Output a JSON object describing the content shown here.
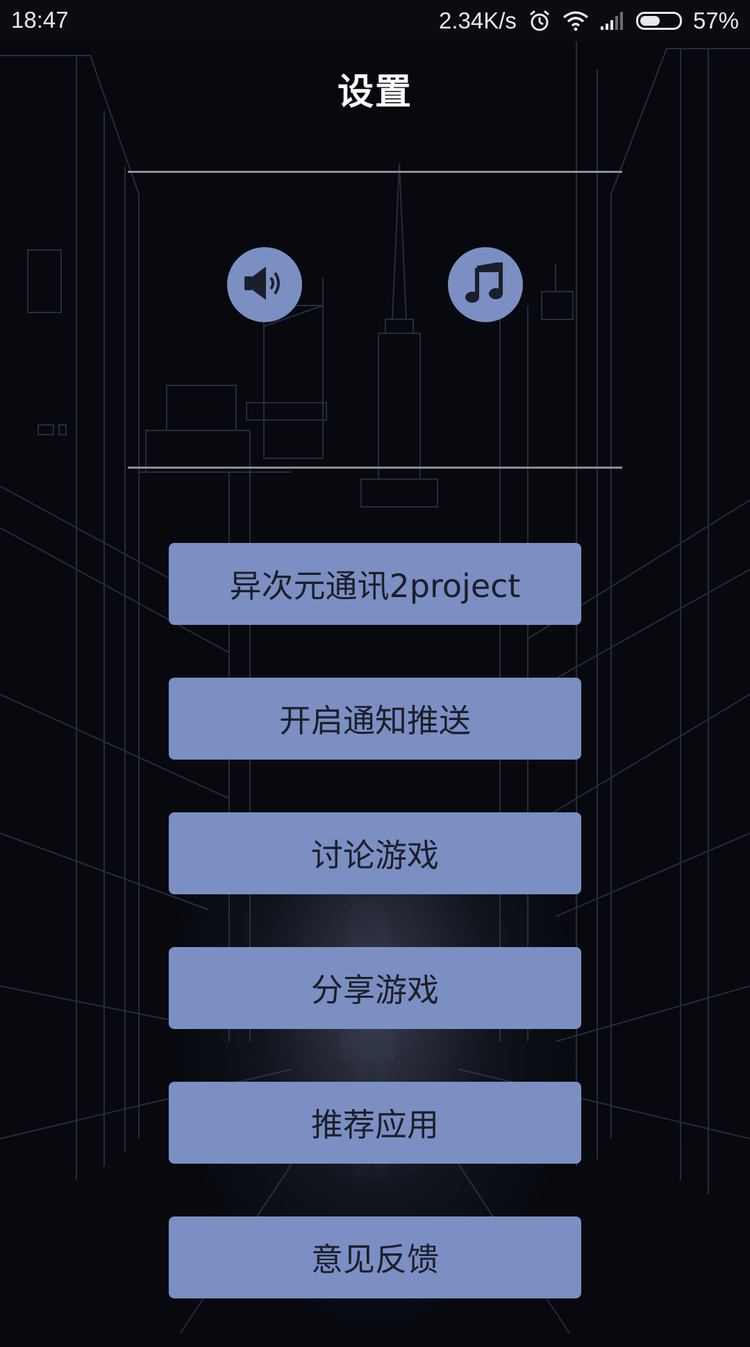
{
  "status_bar": {
    "time": "18:47",
    "network_speed": "2.34K/s",
    "battery_percent": "57%",
    "battery_level": 0.57,
    "icons": [
      "alarm-icon",
      "wifi-icon",
      "signal-icon",
      "battery-icon"
    ]
  },
  "header": {
    "title": "设置"
  },
  "audio_controls": {
    "sound_icon": "speaker-icon",
    "music_icon": "music-note-icon"
  },
  "menu": {
    "items": [
      {
        "label": "异次元通讯2project"
      },
      {
        "label": "开启通知推送"
      },
      {
        "label": "讨论游戏"
      },
      {
        "label": "分享游戏"
      },
      {
        "label": "推荐应用"
      },
      {
        "label": "意见反馈"
      }
    ]
  },
  "colors": {
    "background": "#07090f",
    "accent": "#7b8fc3",
    "button_text": "#1c1f29",
    "divider": "#8c8f99"
  }
}
